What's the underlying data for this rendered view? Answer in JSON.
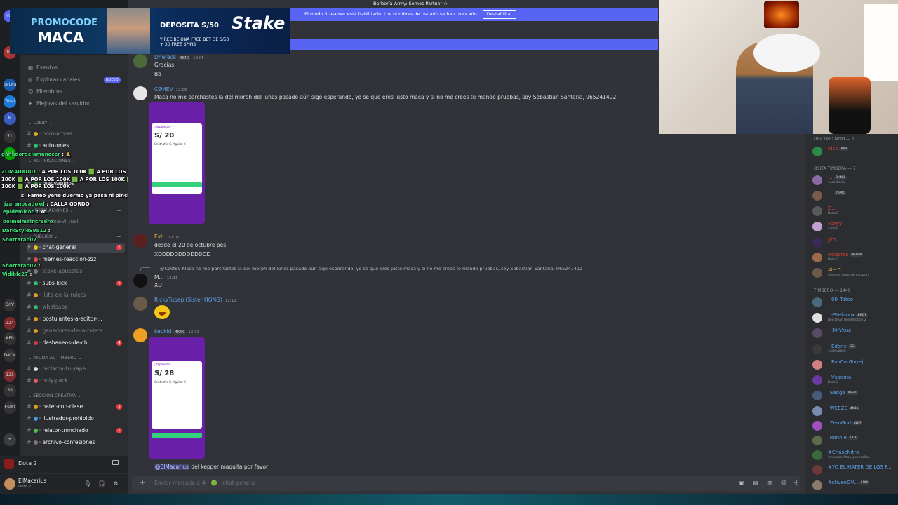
{
  "window": {
    "title": "Barbería Army: Somos Partner ☆"
  },
  "notice": {
    "text": "El modo Streamer está habilitado. Los nombres de usuario se han truncado.",
    "button": "Deshabilitar"
  },
  "promo": {
    "code_label": "PROMOCODE",
    "code": "MACA",
    "deposit": "DEPOSITA S/50",
    "bonus": "Y RECIBE UNA FREE BET DE S/50 + 30 FREE SPINS",
    "brand": "Stake"
  },
  "rail": {
    "items": [
      {
        "label": "NUE"
      },
      {
        "label": "106",
        "badge": "106"
      },
      {
        "label": "betway"
      },
      {
        "label": "Total"
      },
      {
        "label": "M"
      },
      {
        "label": "71"
      },
      {
        "label": "Kick"
      },
      {
        "label": "CnV"
      },
      {
        "label": "224"
      },
      {
        "label": "APh"
      },
      {
        "label": "DAYM"
      },
      {
        "label": "121"
      },
      {
        "label": "SS"
      },
      {
        "label": "EsdD"
      },
      {
        "label": "+"
      }
    ]
  },
  "sidebar": {
    "menu": [
      {
        "icon": "calendar-icon",
        "label": "Eventos"
      },
      {
        "icon": "compass-icon",
        "label": "Explorar canales"
      },
      {
        "icon": "members-icon",
        "label": "Miembros"
      },
      {
        "icon": "gear-icon",
        "label": "Mejoras del servidor"
      }
    ],
    "nuevo": "NUEVO",
    "categories": [
      {
        "label": "LOBBY"
      },
      {
        "label": "NOTIFICACIONES"
      },
      {
        "label": "INSTALACIONES"
      },
      {
        "label": "PÚBLICO"
      },
      {
        "label": "AYUDA AL TIMBERO"
      },
      {
        "label": "SECCIÓN CREATIVA"
      }
    ],
    "channels": [
      {
        "label": "normativas",
        "bright": false
      },
      {
        "label": "auto-roles",
        "bright": true
      },
      {
        "label": "bienvenidos",
        "bright": true
      },
      {
        "label": "oficina-virtual",
        "bright": false
      },
      {
        "label": "chat-general",
        "bright": true,
        "unread": "1"
      },
      {
        "label": "memes-reaccion-zzz",
        "bright": true
      },
      {
        "label": "stake-apuestas",
        "bright": false
      },
      {
        "label": "subs-kick",
        "bright": true,
        "unread": "1"
      },
      {
        "label": "lista-de-la-ruleta",
        "bright": false
      },
      {
        "label": "whatsapp",
        "bright": false
      },
      {
        "label": "postulantes-a-editor-...",
        "bright": true
      },
      {
        "label": "ganadores-de-la-ruleta",
        "bright": false
      },
      {
        "label": "desbaneos-de-ch...",
        "bright": true,
        "unread": "4"
      },
      {
        "label": "reclama-tu-yape",
        "bright": false
      },
      {
        "label": "only-pack",
        "bright": false
      },
      {
        "label": "hater-con-clase",
        "bright": true,
        "unread": "1"
      },
      {
        "label": "ilustrador-prohibido",
        "bright": true
      },
      {
        "label": "relator-tronchado",
        "bright": true,
        "unread": "1"
      },
      {
        "label": "archivo-confesiones",
        "bright": true
      }
    ]
  },
  "overlay": [
    {
      "user": "ganadordelamanecer",
      "text": ": 🙏"
    },
    {
      "user": "ZOMAUXD01",
      "text": ": A POR LOS 100K 🟩 A POR LOS 100K 🟩 A POR LOS 100K"
    },
    {
      "user": "",
      "text": "100K 🟩 A POR LOS 100K 🟩 A POR LOS 100K 🟩 A POR LOS 100K"
    },
    {
      "user": "",
      "text": "100K 🟩 A POR LOS 100K"
    },
    {
      "user": "",
      "text": "s: Fameo yene duermo ya pasa ni pincho"
    },
    {
      "user": "jzaranovadoxd",
      "text": ": CALLA GORDO"
    },
    {
      "user": "epidemicod",
      "text": ": xd"
    },
    {
      "user": "bolmeimaincr8ero",
      "text": ""
    },
    {
      "user": "DarkStyleS9512",
      "text": ":"
    },
    {
      "user": "Shottarap07",
      "text": ""
    },
    {
      "user": "Shottarap07",
      "text": ":"
    },
    {
      "user": "Vidible27",
      "text": ":"
    }
  ],
  "voice": {
    "label": "Dota 2"
  },
  "user": {
    "name": "ElMacarius",
    "status": "Dota 2"
  },
  "messages": [
    {
      "name": "Dhereck",
      "tag": "4K4K",
      "time": "12:05",
      "lines": [
        "Gracias",
        "Bb"
      ]
    },
    {
      "name": "CØИEV",
      "tag": "",
      "time": "12:06",
      "lines": [
        "Maca no me parchastes la del morph del lunes pasado aún sigo esperando, yo se que eres justo maca y si no me crees te mando pruebas, soy Sebastian Santaria, 965241492"
      ]
    },
    {
      "name": "Evil.",
      "tag": "",
      "time": "12:07",
      "lines": [
        "desde el 20 de octubre pes",
        "XDDDDDDDDDDDDD"
      ]
    },
    {
      "name": "M...",
      "tag": "",
      "time": "12:11",
      "reply": "@CØИEV Maca no me parchastes la del morph del lunes pasado aún sigo esperando, yo se que eres justo maca y si no me crees te mando pruebas, soy Sebastian Santaria, 965241492",
      "lines": [
        "XD"
      ]
    },
    {
      "name": "RickyTupapi(Sister HONG)",
      "tag": "",
      "time": "12:11",
      "lines": []
    },
    {
      "name": "keokid",
      "tag": "4K4K",
      "time": "12:13",
      "lines": []
    }
  ],
  "shots": [
    {
      "header": "¡Yapeaste!",
      "amount": "S/ 20",
      "who": "Cristhofer G. Aguilar C",
      "button": "Nuevo Yapeo"
    },
    {
      "header": "¡Yapeaste!",
      "amount": "S/ 28",
      "who": "Cristhofer G. Aguilar C",
      "button": "Nuevo Yapeo"
    }
  ],
  "draft": {
    "mention": "@ElMacarius",
    "text": " del kepper maquita por favor"
  },
  "input": {
    "placeholder": "Enviar mensaje a # · 🟢 · chat-general"
  },
  "members": {
    "groups": [
      {
        "label": "DISCORD MOD — 1"
      },
      {
        "label": "OSITA TIMBERA — 7"
      },
      {
        "label": "TIMBERO — 1449"
      }
    ],
    "list": [
      {
        "name": "Kick",
        "tag": "APP",
        "sub": "",
        "color": "#e0473c"
      },
      {
        "name": "...",
        "tag": "OHNO",
        "sub": "escúchame",
        "color": "#e0473c"
      },
      {
        "name": "...",
        "tag": "ZAMZ",
        "sub": "",
        "color": "#e0473c"
      },
      {
        "name": "D...",
        "tag": "",
        "sub": "Dota 2",
        "color": "#e0473c"
      },
      {
        "name": "Foxyy",
        "tag": "",
        "sub": "calma",
        "color": "#e0473c"
      },
      {
        "name": "Jiro",
        "tag": "",
        "sub": "",
        "color": "#e0473c"
      },
      {
        "name": "Milagros",
        "tag": "MEOW",
        "sub": "Dota 2",
        "color": "#e0473c"
      },
      {
        "name": "Ale D",
        "tag": "",
        "sub": "siempre estas mi corazon",
        "color": "#e0a53c"
      },
      {
        "name": "! 08_Tatoo",
        "tag": "",
        "sub": "",
        "color": "#5ba2e8"
      },
      {
        "name": "! -Stefanox",
        "tag": "BROT",
        "sub": "Red Dead Redemption 2",
        "color": "#5ba2e8"
      },
      {
        "name": "! .MrVeuz",
        "tag": "",
        "sub": "",
        "color": "#5ba2e8"
      },
      {
        "name": "! Edone",
        "tag": "GG",
        "sub": "16/09/2025",
        "color": "#5ba2e8"
      },
      {
        "name": "! PanConTorrej...",
        "tag": "",
        "sub": "",
        "color": "#5ba2e8"
      },
      {
        "name": "! Vsadma",
        "tag": "",
        "sub": "Dota 2",
        "color": "#5ba2e8"
      },
      {
        "name": "!Sadge",
        "tag": "WAAI",
        "sub": "",
        "color": "#5ba2e8"
      },
      {
        "name": "!WEEZE",
        "tag": "4K4K",
        "sub": "",
        "color": "#5ba2e8"
      },
      {
        "name": "!ZeroGod",
        "tag": "EDIT",
        "sub": "",
        "color": "#5ba2e8"
      },
      {
        "name": "!Ronnie",
        "tag": "KICK",
        "sub": "",
        "color": "#5ba2e8"
      },
      {
        "name": "#ChaseNitro",
        "tag": "",
        "sub": "i'm closer than you realize.",
        "color": "#5ba2e8"
      },
      {
        "name": "#YO EL HATER DE LOS F...",
        "tag": "",
        "sub": "",
        "color": "#5ba2e8"
      },
      {
        "name": "#stivenGV...",
        "tag": "LDM",
        "sub": "",
        "color": "#5ba2e8"
      }
    ]
  }
}
